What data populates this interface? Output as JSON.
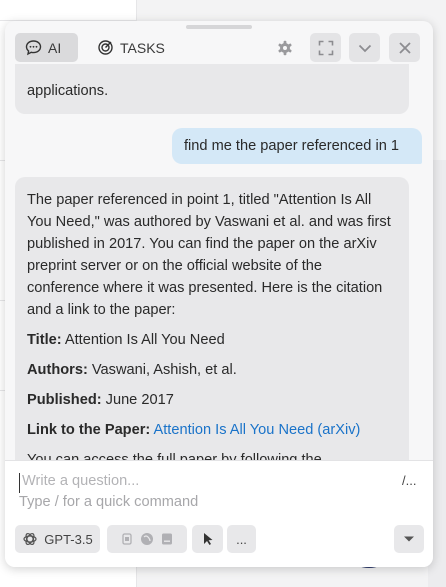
{
  "toolbar": {
    "ai_label": "AI",
    "tasks_label": "TASKS"
  },
  "messages": {
    "prev_ai_tail": "applications.",
    "user_message": "find me the paper referenced in 1",
    "ai_response": {
      "intro": "The paper referenced in point 1, titled \"Attention Is All You Need,\" was authored by Vaswani et al. and was first published in 2017. You can find the paper on the arXiv preprint server or on the official website of the conference where it was presented. Here is the citation and a link to the paper:",
      "title_label": "Title:",
      "title_value": "Attention Is All You Need",
      "authors_label": "Authors:",
      "authors_value": "Vaswani, Ashish, et al.",
      "published_label": "Published:",
      "published_value": "June 2017",
      "link_label": "Link to the Paper:",
      "link_text": "Attention Is All You Need (arXiv)",
      "outro": "You can access the full paper by following the"
    }
  },
  "composer": {
    "placeholder": "Write a question...",
    "hint": "Type / for a quick command",
    "slash_label": "/...",
    "model_label": "GPT-3.5",
    "more_label": "..."
  },
  "colors": {
    "user_bubble": "#d4e8f7",
    "ai_bubble": "#e8e8ea",
    "link": "#1a73c9"
  }
}
